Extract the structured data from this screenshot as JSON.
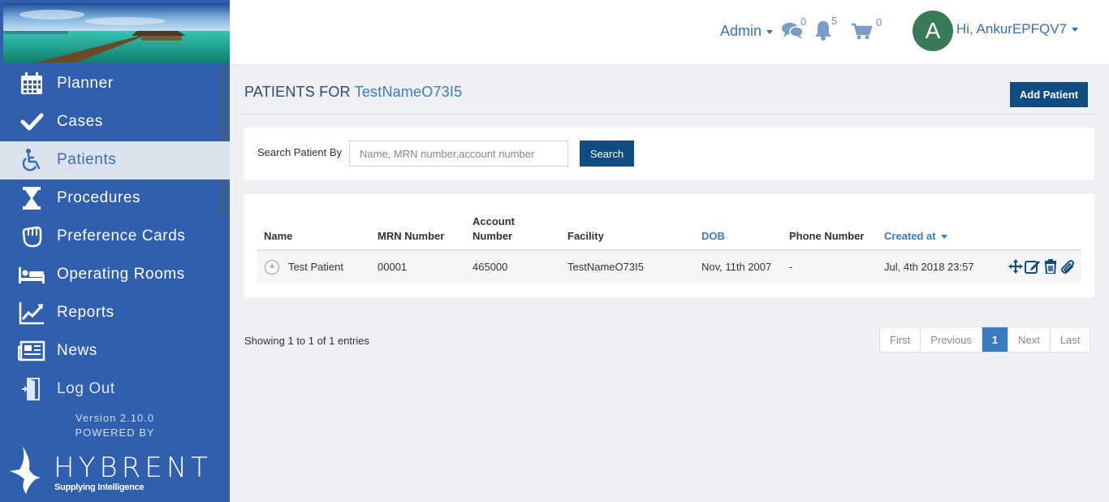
{
  "sidebar": {
    "items": [
      {
        "label": "Planner",
        "icon": "calendar-icon"
      },
      {
        "label": "Cases",
        "icon": "check-icon"
      },
      {
        "label": "Patients",
        "icon": "wheelchair-icon"
      },
      {
        "label": "Procedures",
        "icon": "hourglass-icon"
      },
      {
        "label": "Preference Cards",
        "icon": "hand-icon"
      },
      {
        "label": "Operating Rooms",
        "icon": "bed-icon"
      },
      {
        "label": "Reports",
        "icon": "chart-line-icon"
      },
      {
        "label": "News",
        "icon": "newspaper-icon"
      },
      {
        "label": "Log Out",
        "icon": "logout-door-icon"
      }
    ],
    "active_index": 2,
    "version": "Version 2.10.0",
    "powered_by": "POWERED BY",
    "brand_name": "HYBRENT",
    "brand_tagline": "Supplying Intelligence"
  },
  "topbar": {
    "admin_label": "Admin",
    "messages_count": "0",
    "notifications_count": "5",
    "cart_count": "0",
    "avatar_initial": "A",
    "greeting": "Hi, AnkurEPFQV7"
  },
  "page": {
    "title_prefix": "PATIENTS FOR",
    "title_facility": "TestNameO73I5",
    "add_button": "Add Patient"
  },
  "search": {
    "label": "Search Patient By",
    "placeholder": "Name, MRN number,account number",
    "value": "",
    "button": "Search"
  },
  "table": {
    "headers": {
      "name": "Name",
      "mrn": "MRN Number",
      "account_line1": "Account",
      "account_line2": "Number",
      "facility": "Facility",
      "dob": "DOB",
      "phone": "Phone Number",
      "created": "Created at"
    },
    "rows": [
      {
        "expander": "+",
        "name": "Test Patient",
        "mrn": "00001",
        "account": "465000",
        "facility": "TestNameO73I5",
        "dob": "Nov, 11th 2007",
        "phone": "-",
        "created": "Jul, 4th 2018 23:57"
      }
    ]
  },
  "pagination": {
    "summary": "Showing 1 to 1 of 1 entries",
    "first": "First",
    "previous": "Previous",
    "current": "1",
    "next": "Next",
    "last": "Last"
  },
  "colors": {
    "sidebar_bg": "#2f5fad",
    "accent": "#3a7cc0",
    "primary_button": "#0f4c81",
    "avatar_bg": "#3b7a57"
  }
}
